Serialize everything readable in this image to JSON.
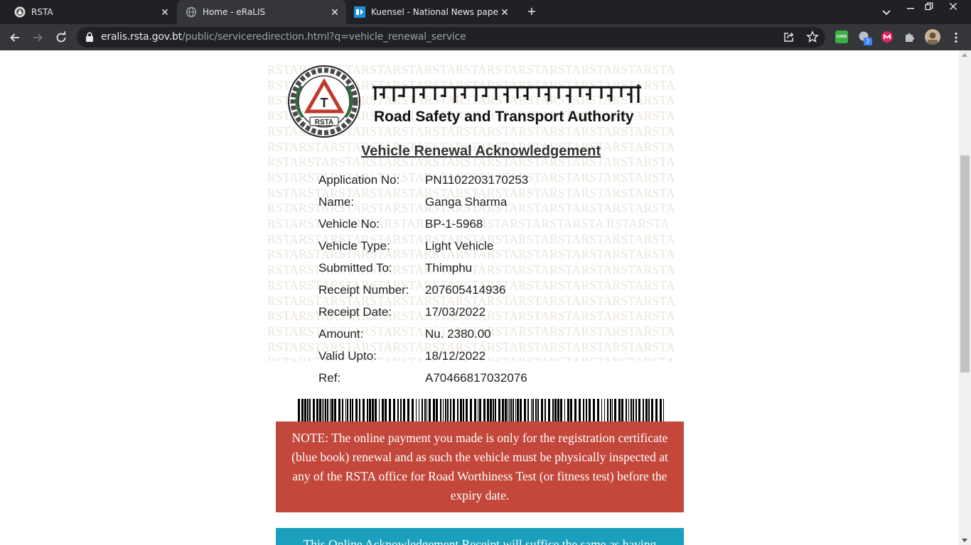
{
  "tabs": [
    {
      "title": "RSTA",
      "active": false
    },
    {
      "title": "Home - eRaLIS",
      "active": true
    },
    {
      "title": "Kuensel - National News paper o",
      "active": false
    }
  ],
  "toolbar": {
    "url_host": "eralis.rsta.gov.bt",
    "url_path": "/public/serviceredirection.html?q=vehicle_renewal_service",
    "ext_badge": "2",
    "ext_cors": "CORS"
  },
  "header": {
    "org_name": "Road Safety and Transport Authority",
    "dzongkha_name": "ལམ་འགྲུལ་ཉེན་སྲུང་དང་སྐྱེལ་འདྲེན་དབང་འཛིན།",
    "logo_text": "RSTA",
    "logo_letter": "T"
  },
  "watermark_text": "RSTARSTARSTARSTARSTARSTARSTARSTARSTARSTARSTARSTARSTA",
  "watermark_row11": "RSTARSTASTARSTARSTARSTARSTARSTARSTARSTARSTA RSTARSTA",
  "acknowledgement": {
    "title": "Vehicle Renewal Acknowledgement",
    "rows": [
      {
        "label": "Application No:",
        "value": "PN1102203170253"
      },
      {
        "label": "Name:",
        "value": "Ganga Sharma"
      },
      {
        "label": "Vehicle No:",
        "value": "BP-1-5968"
      },
      {
        "label": "Vehicle Type:",
        "value": "Light Vehicle"
      },
      {
        "label": "Submitted To:",
        "value": "Thimphu"
      },
      {
        "label": "Receipt Number:",
        "value": "207605414936"
      },
      {
        "label": "Receipt Date:",
        "value": "17/03/2022"
      },
      {
        "label": "Amount:",
        "value": "Nu. 2380.00"
      },
      {
        "label": "Valid Upto:",
        "value": "18/12/2022"
      },
      {
        "label": "Ref:",
        "value": "A70466817032076"
      }
    ]
  },
  "note": "NOTE: The online payment you made is only for the registration certificate (blue book) renewal and as such the vehicle must be physically inspected at any of the RSTA office for Road Worthiness Test (or fitness test) before the expiry date.",
  "note2": "This Online Acknowledgement Receipt will suffice the same as having",
  "colors": {
    "note_bg": "#c3473a",
    "note2_bg": "#1aa0bd",
    "watermark": "#ebe5dd",
    "tab_active": "#35363a"
  }
}
